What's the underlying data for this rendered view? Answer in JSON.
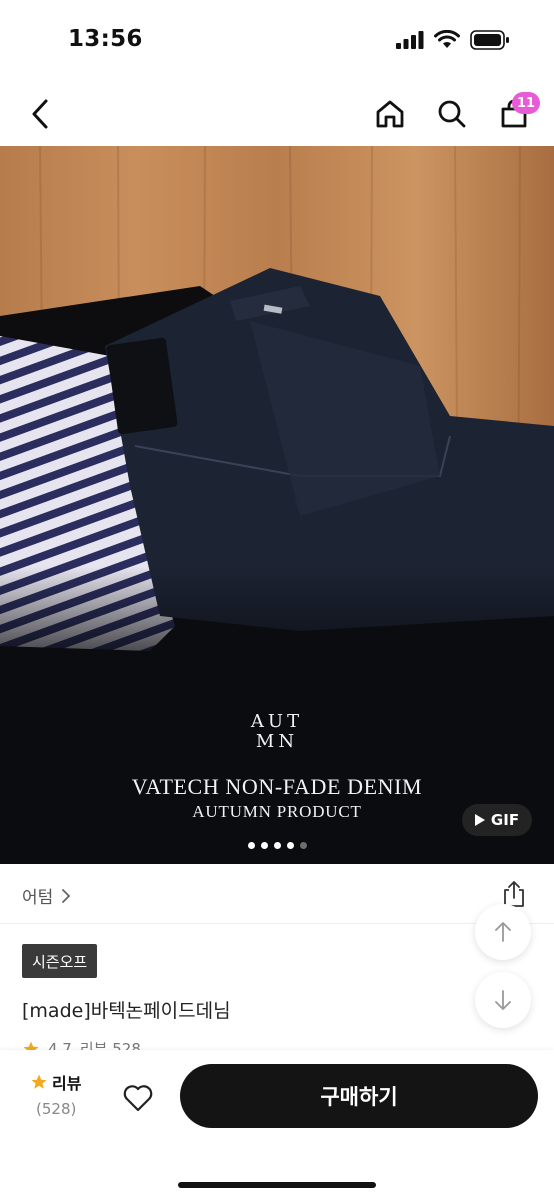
{
  "status_bar": {
    "time": "13:56",
    "icons": [
      "signal-icon",
      "wifi-icon",
      "battery-icon"
    ]
  },
  "nav": {
    "icons": [
      "back-chevron-icon",
      "home-icon",
      "search-icon",
      "shopping-bag-icon"
    ],
    "cart_count": "11",
    "badge_color": "#e85bd6"
  },
  "hero": {
    "logo_top": "AUT",
    "logo_bottom": "MN",
    "title": "VATECH NON-FADE DENIM",
    "subtitle": "AUTUMN PRODUCT",
    "gif_label": "GIF",
    "slide_count": 5,
    "active_slide": 4
  },
  "brand": {
    "name": "어텀",
    "share_icon": "share-icon"
  },
  "product": {
    "season_tag": "시즌오프",
    "name": "[made]바텍논페이드데님",
    "rating": "4.7",
    "review_text": "리뷰 528"
  },
  "float_buttons": {
    "up_icon": "arrow-up-icon",
    "down_icon": "arrow-down-icon"
  },
  "bottom_bar": {
    "review_label": "리뷰",
    "review_count": "(528)",
    "buy_label": "구매하기",
    "star_color": "#f2a91d",
    "button_color": "#141414"
  }
}
